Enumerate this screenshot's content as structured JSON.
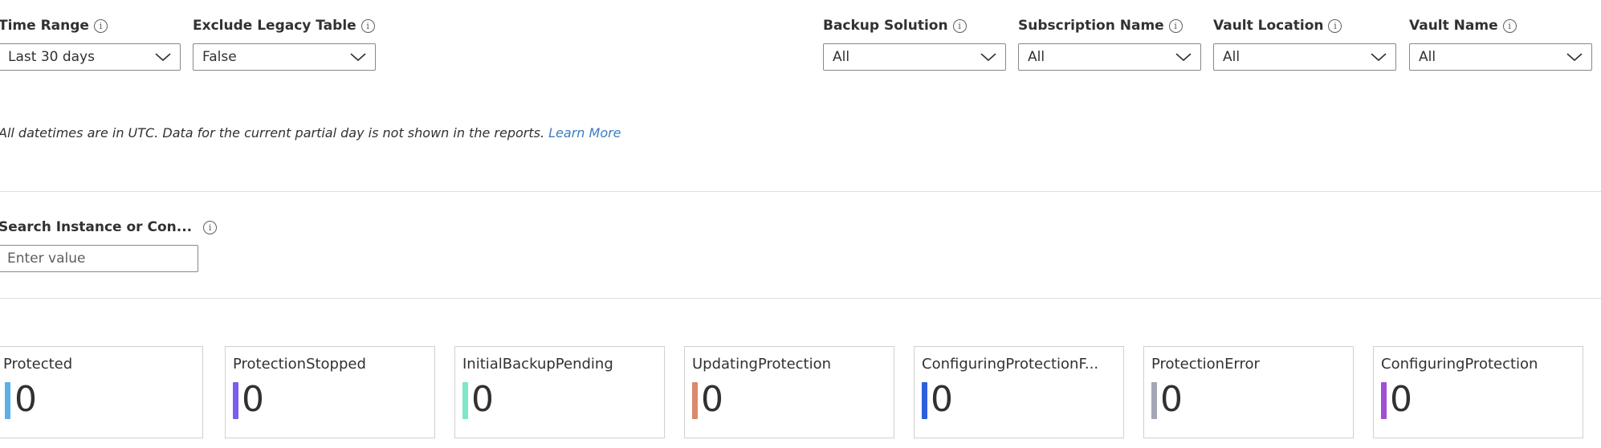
{
  "filters": [
    {
      "label": "Time Range",
      "value": "Last 30 days"
    },
    {
      "label": "Exclude Legacy Table",
      "value": "False"
    },
    {
      "label": "Backup Solution",
      "value": "All"
    },
    {
      "label": "Subscription Name",
      "value": "All"
    },
    {
      "label": "Vault Location",
      "value": "All"
    },
    {
      "label": "Vault Name",
      "value": "All"
    }
  ],
  "info_icon_glyph": "i",
  "note": {
    "text": "All datetimes are in UTC. Data for the current partial day is not shown in the reports.",
    "link": "Learn More"
  },
  "search": {
    "label": "Search Instance or Con...",
    "placeholder": "Enter value",
    "value": ""
  },
  "tiles": [
    {
      "title": "Protected",
      "value": "0",
      "color": "#5bb0e8"
    },
    {
      "title": "ProtectionStopped",
      "value": "0",
      "color": "#7b5cf0"
    },
    {
      "title": "InitialBackupPending",
      "value": "0",
      "color": "#7fe6c8"
    },
    {
      "title": "UpdatingProtection",
      "value": "0",
      "color": "#d98a6c"
    },
    {
      "title": "ConfiguringProtectionF...",
      "value": "0",
      "color": "#2c5fde"
    },
    {
      "title": "ProtectionError",
      "value": "0",
      "color": "#a3a6b4"
    },
    {
      "title": "ConfiguringProtection",
      "value": "0",
      "color": "#a04fd3"
    }
  ],
  "icons": {
    "info": "info-icon",
    "dropdown": "chevron-down-icon"
  }
}
